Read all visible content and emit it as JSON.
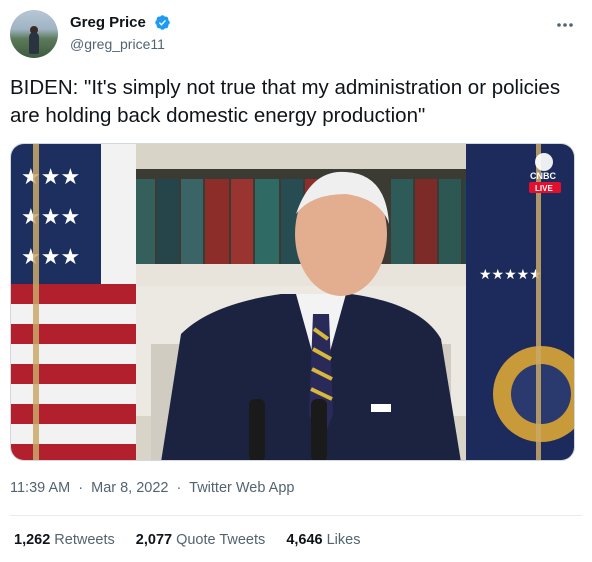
{
  "author": {
    "display_name": "Greg Price",
    "handle": "@greg_price11",
    "avatar_icon": "avatar-photo",
    "verified_icon": "verified-badge-icon",
    "verified_color": "#1d9bf0"
  },
  "tweet": {
    "text": "BIDEN: \"It's simply not true that my administration or policies are holding back domestic energy production\""
  },
  "media": {
    "watermark": "CNBC",
    "live_badge": "LIVE",
    "live_color": "#e0102e"
  },
  "meta": {
    "time": "11:39 AM",
    "separator": "·",
    "date": "Mar 8, 2022",
    "source": "Twitter Web App"
  },
  "stats": [
    {
      "count": "1,262",
      "label": "Retweets"
    },
    {
      "count": "2,077",
      "label": "Quote Tweets"
    },
    {
      "count": "4,646",
      "label": "Likes"
    }
  ],
  "icons": {
    "more": "more-options-icon"
  }
}
